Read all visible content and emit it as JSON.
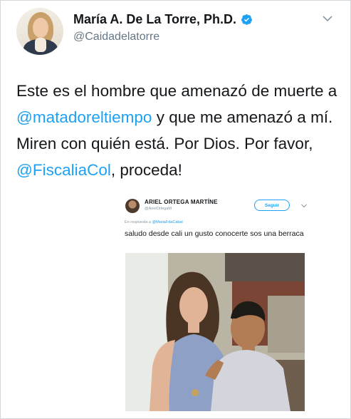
{
  "tweet": {
    "display_name": "María A. De La Torre, Ph.D.",
    "handle": "@Caidadelatorre",
    "text_parts": [
      "Este es el hombre que amenazó de muerte a ",
      "@matadoreltiempo",
      " y que me amenazó a mí. Miren con quién está. Por Dios. Por favor, ",
      "@FiscaliaCol",
      ", proceda!"
    ],
    "icons": {
      "verified": "verified-badge-icon",
      "menu": "chevron-down-icon"
    },
    "colors": {
      "link": "#1da1f2",
      "verified": "#1da1f2",
      "text": "#14171a",
      "secondary": "#657786"
    }
  },
  "embedded": {
    "name": "ARIEL ORTEGA MARTÍNE",
    "handle": "@ArielOrtegaM",
    "follow_label": "Seguir",
    "reply_prefix": "En respuesta a ",
    "reply_to": "@MariaFdaCabal",
    "text": "saludo desde cali un gusto conocerte sos una berraca"
  }
}
